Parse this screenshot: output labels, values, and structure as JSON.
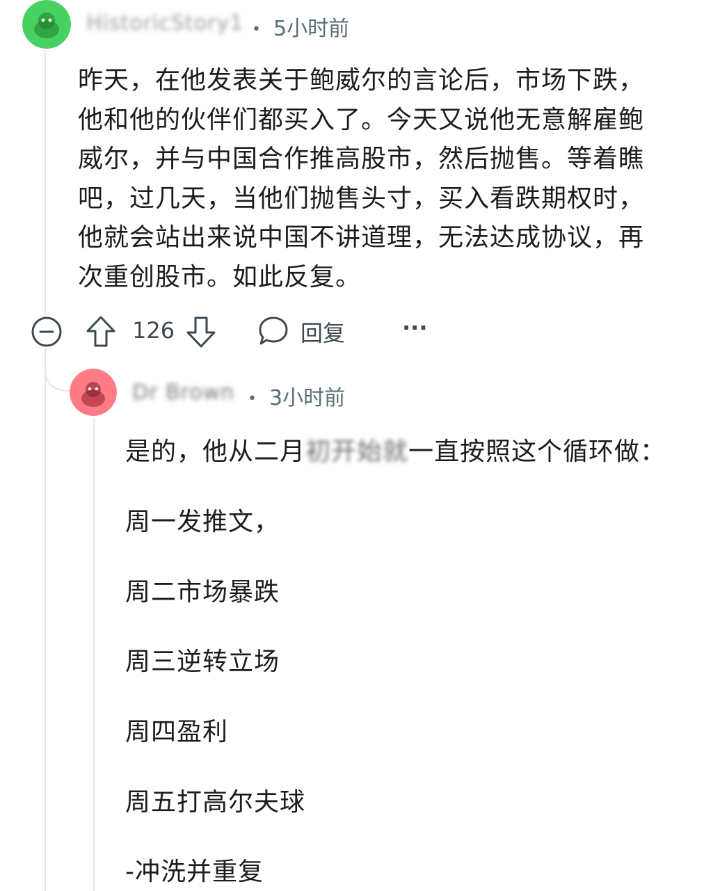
{
  "comment": {
    "username": "HistoricStory1",
    "time": "5小时前",
    "body": "昨天，在他发表关于鲍威尔的言论后，市场下跌，他和他的伙伴们都买入了。今天又说他无意解雇鲍威尔，并与中国合作推高股市，然后抛售。等着瞧吧，过几天，当他们抛售头寸，买入看跌期权时，他就会站出来说中国不讲道理，无法达成协议，再次重创股市。如此反复。",
    "body_lines": [
      "昨天，在他发表关于鲍威尔的言论后，市场下跌，",
      "他和他的伙伴们都买入了。今天又说他无意解雇鲍",
      "威尔，并与中国合作推高股市，然后抛售。等着瞧",
      "吧，过几天，当他们抛售头寸，买入看跌期权时，",
      "他就会站出来说中国不讲道理，无法达成协议，再",
      "次重创股市。如此反复。"
    ],
    "vote_count": "126",
    "reply_label": "回复",
    "more_label": "···",
    "avatar_color": "#46d160"
  },
  "reply": {
    "username": "Dr Brown",
    "time": "3小时前",
    "avatar_color": "#ff7b85",
    "lines": {
      "intro_before": "是的，他从二月",
      "intro_blurred": "初开始就",
      "intro_after": "一直按照这个循环做：",
      "mon": "周一发推文，",
      "tue": "周二市场暴跌",
      "wed": "周三逆转立场",
      "thu": "周四盈利",
      "fri": "周五打高尔夫球",
      "repeat": "-冲洗并重复"
    }
  },
  "colors": {
    "text": "#1c1c1c",
    "meta": "#576f76",
    "thread_line": "#e4e6e8"
  }
}
